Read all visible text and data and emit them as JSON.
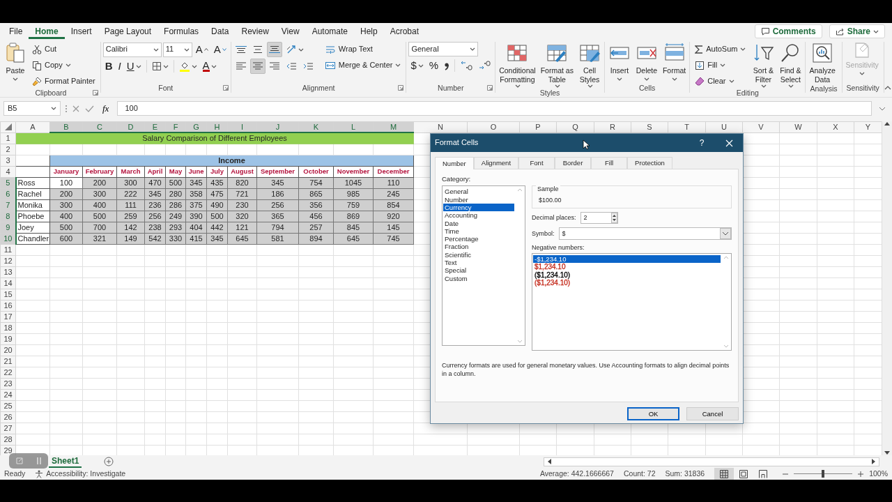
{
  "menu_tabs": [
    {
      "label": "File",
      "selected": false
    },
    {
      "label": "Home",
      "selected": true
    },
    {
      "label": "Insert",
      "selected": false
    },
    {
      "label": "Page Layout",
      "selected": false
    },
    {
      "label": "Formulas",
      "selected": false
    },
    {
      "label": "Data",
      "selected": false
    },
    {
      "label": "Review",
      "selected": false
    },
    {
      "label": "View",
      "selected": false
    },
    {
      "label": "Automate",
      "selected": false
    },
    {
      "label": "Help",
      "selected": false
    },
    {
      "label": "Acrobat",
      "selected": false
    }
  ],
  "comments_button": "Comments",
  "share_button": "Share",
  "ribbon": {
    "clipboard": {
      "label": "Clipboard",
      "paste": "Paste",
      "cut": "Cut",
      "copy": "Copy",
      "format_painter": "Format Painter"
    },
    "font": {
      "label": "Font",
      "font_name": "Calibri",
      "font_size": "11",
      "grow": "A",
      "shrink": "A",
      "bold": "B",
      "italic": "I",
      "underline": "U",
      "font_color": "A"
    },
    "alignment": {
      "label": "Alignment",
      "vertical": [
        {
          "kind": "top",
          "selected": false
        },
        {
          "kind": "middle",
          "selected": false
        },
        {
          "kind": "bottom",
          "selected": true
        }
      ],
      "horizontal": [
        {
          "kind": "left",
          "selected": false
        },
        {
          "kind": "center",
          "selected": true
        },
        {
          "kind": "right",
          "selected": false
        }
      ],
      "wrap_text": "Wrap Text",
      "merge_center": "Merge & Center"
    },
    "number": {
      "label": "Number",
      "format": "General",
      "currency": "$",
      "percent": "%"
    },
    "styles": {
      "label": "Styles",
      "buttons": [
        [
          "Conditional",
          "Formatting"
        ],
        [
          "Format as",
          "Table"
        ],
        [
          "Cell",
          "Styles"
        ]
      ]
    },
    "cells": {
      "label": "Cells",
      "buttons": [
        "Insert",
        "Delete",
        "Format"
      ]
    },
    "editing": {
      "label": "Editing",
      "autosum": "AutoSum",
      "fill": "Fill",
      "clear": "Clear",
      "sort_filter": [
        "Sort &",
        "Filter"
      ],
      "find_select": [
        "Find &",
        "Select"
      ]
    },
    "analysis": {
      "label": "Analysis",
      "analyze_data": [
        "Analyze",
        "Data"
      ]
    },
    "sensitivity": {
      "label": "Sensitivity",
      "button": "Sensitivity",
      "disabled": true
    }
  },
  "formula_bar": {
    "name_box": "B5",
    "function_label": "fx",
    "formula": "100"
  },
  "sheet": {
    "columns": [
      {
        "label": "A",
        "selected": false
      },
      {
        "label": "B",
        "selected": true
      },
      {
        "label": "C",
        "selected": true
      },
      {
        "label": "D",
        "selected": true
      },
      {
        "label": "E",
        "selected": true
      },
      {
        "label": "F",
        "selected": true
      },
      {
        "label": "G",
        "selected": true
      },
      {
        "label": "H",
        "selected": true
      },
      {
        "label": "I",
        "selected": true
      },
      {
        "label": "J",
        "selected": true
      },
      {
        "label": "K",
        "selected": true
      },
      {
        "label": "L",
        "selected": true
      },
      {
        "label": "M",
        "selected": true
      },
      {
        "label": "N",
        "selected": false
      },
      {
        "label": "O",
        "selected": false
      },
      {
        "label": "P",
        "selected": false
      },
      {
        "label": "Q",
        "selected": false
      },
      {
        "label": "R",
        "selected": false
      },
      {
        "label": "S",
        "selected": false
      },
      {
        "label": "T",
        "selected": false
      },
      {
        "label": "U",
        "selected": false
      },
      {
        "label": "V",
        "selected": false
      },
      {
        "label": "W",
        "selected": false
      },
      {
        "label": "X",
        "selected": false
      },
      {
        "label": "Y",
        "selected": false
      }
    ],
    "rows": [
      {
        "label": "1",
        "selected": false
      },
      {
        "label": "2",
        "selected": false
      },
      {
        "label": "3",
        "selected": false
      },
      {
        "label": "4",
        "selected": false
      },
      {
        "label": "5",
        "selected": true
      },
      {
        "label": "6",
        "selected": true
      },
      {
        "label": "7",
        "selected": true
      },
      {
        "label": "8",
        "selected": true
      },
      {
        "label": "9",
        "selected": true
      },
      {
        "label": "10",
        "selected": true
      },
      {
        "label": "11",
        "selected": false
      },
      {
        "label": "12",
        "selected": false
      },
      {
        "label": "13",
        "selected": false
      },
      {
        "label": "14",
        "selected": false
      },
      {
        "label": "15",
        "selected": false
      },
      {
        "label": "16",
        "selected": false
      },
      {
        "label": "17",
        "selected": false
      },
      {
        "label": "18",
        "selected": false
      },
      {
        "label": "19",
        "selected": false
      },
      {
        "label": "20",
        "selected": false
      },
      {
        "label": "21",
        "selected": false
      },
      {
        "label": "22",
        "selected": false
      },
      {
        "label": "23",
        "selected": false
      },
      {
        "label": "24",
        "selected": false
      },
      {
        "label": "25",
        "selected": false
      },
      {
        "label": "26",
        "selected": false
      },
      {
        "label": "27",
        "selected": false
      },
      {
        "label": "28",
        "selected": false
      },
      {
        "label": "29",
        "selected": false
      }
    ],
    "title": "Salary Comparison of Different Employees",
    "group_header": "Income",
    "months": [
      "January",
      "February",
      "March",
      "April",
      "May",
      "June",
      "July",
      "August",
      "September",
      "October",
      "November",
      "December"
    ],
    "employees": [
      {
        "name": "Ross",
        "cells": [
          {
            "value": "100",
            "active": true
          },
          {
            "value": "200",
            "active": false
          },
          {
            "value": "300",
            "active": false
          },
          {
            "value": "470",
            "active": false
          },
          {
            "value": "500",
            "active": false
          },
          {
            "value": "345",
            "active": false
          },
          {
            "value": "435",
            "active": false
          },
          {
            "value": "820",
            "active": false
          },
          {
            "value": "345",
            "active": false
          },
          {
            "value": "754",
            "active": false
          },
          {
            "value": "1045",
            "active": false
          },
          {
            "value": "110",
            "active": false
          }
        ]
      },
      {
        "name": "Rachel",
        "cells": [
          {
            "value": "200",
            "active": false
          },
          {
            "value": "300",
            "active": false
          },
          {
            "value": "222",
            "active": false
          },
          {
            "value": "345",
            "active": false
          },
          {
            "value": "280",
            "active": false
          },
          {
            "value": "358",
            "active": false
          },
          {
            "value": "475",
            "active": false
          },
          {
            "value": "721",
            "active": false
          },
          {
            "value": "186",
            "active": false
          },
          {
            "value": "865",
            "active": false
          },
          {
            "value": "985",
            "active": false
          },
          {
            "value": "245",
            "active": false
          }
        ]
      },
      {
        "name": "Monika",
        "cells": [
          {
            "value": "300",
            "active": false
          },
          {
            "value": "400",
            "active": false
          },
          {
            "value": "111",
            "active": false
          },
          {
            "value": "236",
            "active": false
          },
          {
            "value": "286",
            "active": false
          },
          {
            "value": "375",
            "active": false
          },
          {
            "value": "490",
            "active": false
          },
          {
            "value": "230",
            "active": false
          },
          {
            "value": "256",
            "active": false
          },
          {
            "value": "356",
            "active": false
          },
          {
            "value": "759",
            "active": false
          },
          {
            "value": "854",
            "active": false
          }
        ]
      },
      {
        "name": "Phoebe",
        "cells": [
          {
            "value": "400",
            "active": false
          },
          {
            "value": "500",
            "active": false
          },
          {
            "value": "259",
            "active": false
          },
          {
            "value": "256",
            "active": false
          },
          {
            "value": "249",
            "active": false
          },
          {
            "value": "390",
            "active": false
          },
          {
            "value": "500",
            "active": false
          },
          {
            "value": "320",
            "active": false
          },
          {
            "value": "365",
            "active": false
          },
          {
            "value": "456",
            "active": false
          },
          {
            "value": "869",
            "active": false
          },
          {
            "value": "920",
            "active": false
          }
        ]
      },
      {
        "name": "Joey",
        "cells": [
          {
            "value": "500",
            "active": false
          },
          {
            "value": "700",
            "active": false
          },
          {
            "value": "142",
            "active": false
          },
          {
            "value": "238",
            "active": false
          },
          {
            "value": "293",
            "active": false
          },
          {
            "value": "404",
            "active": false
          },
          {
            "value": "442",
            "active": false
          },
          {
            "value": "121",
            "active": false
          },
          {
            "value": "794",
            "active": false
          },
          {
            "value": "257",
            "active": false
          },
          {
            "value": "845",
            "active": false
          },
          {
            "value": "145",
            "active": false
          }
        ]
      },
      {
        "name": "Chandler",
        "cells": [
          {
            "value": "600",
            "active": false
          },
          {
            "value": "321",
            "active": false
          },
          {
            "value": "149",
            "active": false
          },
          {
            "value": "542",
            "active": false
          },
          {
            "value": "330",
            "active": false
          },
          {
            "value": "415",
            "active": false
          },
          {
            "value": "345",
            "active": false
          },
          {
            "value": "645",
            "active": false
          },
          {
            "value": "581",
            "active": false
          },
          {
            "value": "894",
            "active": false
          },
          {
            "value": "645",
            "active": false
          },
          {
            "value": "745",
            "active": false
          }
        ]
      }
    ]
  },
  "dialog": {
    "title": "Format Cells",
    "help": "?",
    "tabs": [
      {
        "label": "Number",
        "selected": true
      },
      {
        "label": "Alignment",
        "selected": false
      },
      {
        "label": "Font",
        "selected": false
      },
      {
        "label": "Border",
        "selected": false
      },
      {
        "label": "Fill",
        "selected": false
      },
      {
        "label": "Protection",
        "selected": false
      }
    ],
    "category_label": "Category:",
    "categories": [
      {
        "label": "General",
        "selected": false
      },
      {
        "label": "Number",
        "selected": false
      },
      {
        "label": "Currency",
        "selected": true
      },
      {
        "label": "Accounting",
        "selected": false
      },
      {
        "label": "Date",
        "selected": false
      },
      {
        "label": "Time",
        "selected": false
      },
      {
        "label": "Percentage",
        "selected": false
      },
      {
        "label": "Fraction",
        "selected": false
      },
      {
        "label": "Scientific",
        "selected": false
      },
      {
        "label": "Text",
        "selected": false
      },
      {
        "label": "Special",
        "selected": false
      },
      {
        "label": "Custom",
        "selected": false
      }
    ],
    "sample_label": "Sample",
    "sample_value": "$100.00",
    "decimal_label": "Decimal places:",
    "decimal_value": "2",
    "symbol_label": "Symbol:",
    "symbol_value": "$",
    "negative_label": "Negative numbers:",
    "negative_formats": [
      {
        "label": "-$1,234.10",
        "selected": true
      },
      {
        "label": "$1,234.10",
        "color": "#c42b1c",
        "selected": false
      },
      {
        "label": "($1,234.10)",
        "color": "#000000",
        "selected": false
      },
      {
        "label": "($1,234.10)",
        "color": "#c42b1c",
        "selected": false
      }
    ],
    "description": "Currency formats are used for general monetary values.  Use Accounting formats to align decimal points in a column.",
    "ok": "OK",
    "cancel": "Cancel"
  },
  "sheet_tabs": [
    {
      "label": "Sheet1",
      "selected": true
    }
  ],
  "status_bar": {
    "ready": "Ready",
    "accessibility": "Accessibility: Investigate",
    "average": "Average: 442.1666667",
    "count": "Count: 72",
    "sum": "Sum: 31836",
    "views": [
      {
        "kind": "normal",
        "selected": true
      },
      {
        "kind": "page_layout",
        "selected": false
      },
      {
        "kind": "page_break",
        "selected": false
      }
    ],
    "zoom": {
      "level": 0.5
    },
    "zoom_label": "100%"
  }
}
